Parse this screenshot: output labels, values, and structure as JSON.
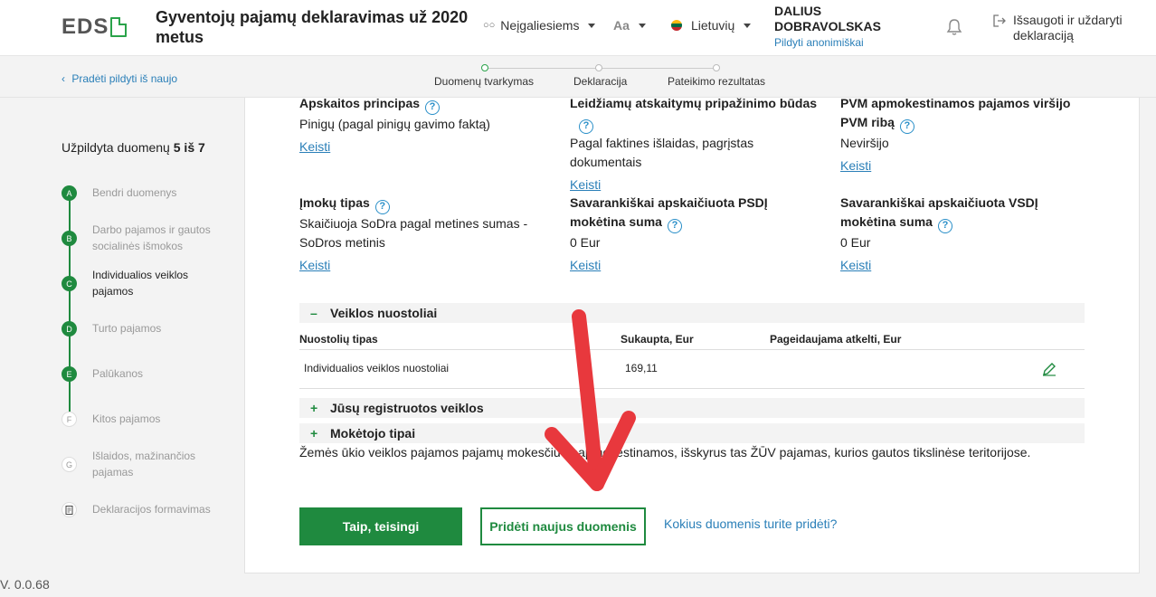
{
  "header": {
    "logo_text": "EDS",
    "title": "Gyventojų pajamų deklaravimas už 2020 metus",
    "accessibility_label": "Neįgaliesiems",
    "font_label": "Aa",
    "language_label": "Lietuvių",
    "user_name": "DALIUS DOBRAVOLSKAS",
    "anon_link": "Pildyti anonimiškai",
    "save_exit_label": "Išsaugoti ir uždaryti deklaraciją"
  },
  "subbar": {
    "restart_label": "Pradėti pildyti iš naujo",
    "steps": [
      "Duomenų tvarkymas",
      "Deklaracija",
      "Pateikimo rezultatas"
    ]
  },
  "sidebar": {
    "progress_prefix": "Užpildyta duomenų",
    "progress_value": "5 iš 7",
    "items": [
      {
        "letter": "A",
        "label": "Bendri duomenys"
      },
      {
        "letter": "B",
        "label": "Darbo pajamos ir gautos socialinės išmokos"
      },
      {
        "letter": "C",
        "label": "Individualios veiklos pajamos"
      },
      {
        "letter": "D",
        "label": "Turto pajamos"
      },
      {
        "letter": "E",
        "label": "Palūkanos"
      },
      {
        "letter": "F",
        "label": "Kitos pajamos"
      },
      {
        "letter": "G",
        "label": "Išlaidos, mažinančios pajamas"
      },
      {
        "letter": "",
        "label": "Deklaracijos formavimas"
      }
    ],
    "version": "V. 0.0.68"
  },
  "fields": {
    "f1": {
      "label": "Apskaitos principas",
      "value": "Pinigų (pagal pinigų gavimo faktą)",
      "link": "Keisti"
    },
    "f2": {
      "label": "Leidžiamų atskaitymų pripažinimo būdas",
      "value": "Pagal faktines išlaidas, pagrįstas dokumentais",
      "link": "Keisti"
    },
    "f3": {
      "label": "PVM apmokestinamos pajamos viršijo PVM ribą",
      "value": "Neviršijo",
      "link": "Keisti"
    },
    "f4": {
      "label": "Įmokų tipas",
      "value": "Skaičiuoja SoDra pagal metines sumas - SoDros metinis",
      "link": "Keisti"
    },
    "f5": {
      "label": "Savarankiškai apskaičiuota PSDĮ mokėtina suma",
      "value": "0 Eur",
      "link": "Keisti"
    },
    "f6": {
      "label": "Savarankiškai apskaičiuota VSDĮ mokėtina suma",
      "value": "0 Eur",
      "link": "Keisti"
    }
  },
  "expenses": {
    "title": "Veiklos nuostoliai",
    "columns": [
      "Nuostolių tipas",
      "Sukaupta, Eur",
      "Pageidaujama atkelti, Eur"
    ],
    "rows": [
      {
        "type": "Individualios veiklos nuostoliai",
        "accrued": "169,11",
        "carry": ""
      }
    ]
  },
  "sections": {
    "registered": "Jūsų registruotos veiklos",
    "payers": "Mokėtojo tipai"
  },
  "paragraph": "Žemės ūkio veiklos pajamos pajamų mokesčiu neapmokestinamos, išskyrus tas ŽŪV pajamas, kurios gautos tikslinėse teritorijose.",
  "actions": {
    "confirm": "Taip, teisingi",
    "add_new": "Pridėti naujus duomenis",
    "help": "Kokius duomenis turite pridėti?"
  },
  "colors": {
    "brand_green": "#1f8a3f",
    "link_blue": "#2a7fb8",
    "annotation_red": "#e8383d"
  }
}
